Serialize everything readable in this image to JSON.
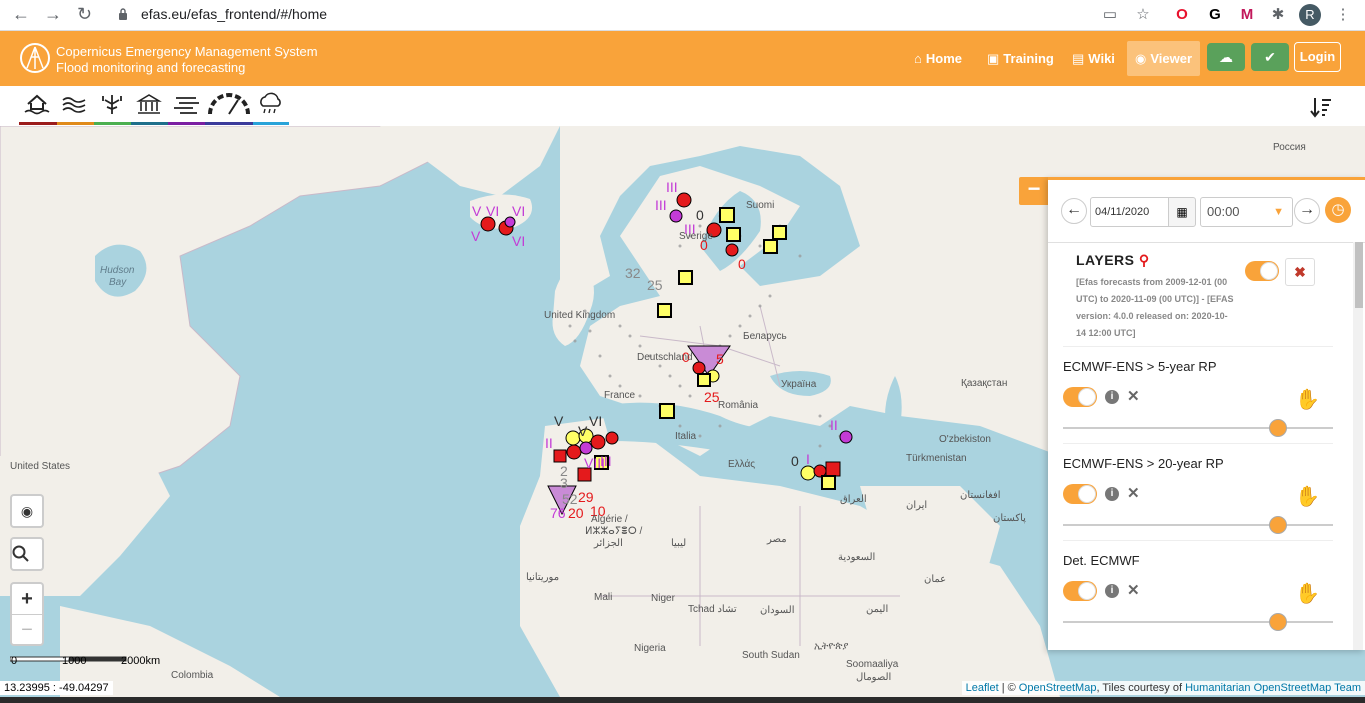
{
  "browser": {
    "url": "efas.eu/efas_frontend/#/home",
    "profile_initial": "R"
  },
  "header": {
    "title_line1": "Copernicus Emergency Management System",
    "title_line2": "Flood monitoring and forecasting",
    "menu": [
      {
        "label": "Home",
        "icon": "home-icon"
      },
      {
        "label": "Training",
        "icon": "training-icon"
      },
      {
        "label": "Wiki",
        "icon": "wiki-icon"
      },
      {
        "label": "Viewer",
        "icon": "globe-icon"
      }
    ],
    "login_label": "Login",
    "accent": "#f9a33a"
  },
  "toolbar": {
    "tools": [
      {
        "name": "flood-tool",
        "color": "#9b1c1c"
      },
      {
        "name": "river-tool",
        "color": "#e08a1a"
      },
      {
        "name": "tree-tool",
        "color": "#4caf50"
      },
      {
        "name": "building-tool",
        "color": "#1f6f8b"
      },
      {
        "name": "layers-tool",
        "color": "#7b1fa2"
      },
      {
        "name": "gauge-tool",
        "color": "#3b3b9b"
      },
      {
        "name": "rain-tool",
        "color": "#29a3d9"
      }
    ]
  },
  "map": {
    "labels": {
      "russia": "Россия",
      "hudson": "Hudson",
      "bay": "Bay",
      "uk": "United Kingdom",
      "suomi": "Suomi",
      "sverige": "Sverige",
      "belarus": "Беларусь",
      "deutschland": "Deutschland",
      "ukraine": "Україна",
      "kazakhstan": "Қазақстан",
      "france": "France",
      "romania": "România",
      "italia": "Italia",
      "ellas": "Ελλάς",
      "uzbekistan": "O'zbekiston",
      "turkmenistan": "Türkmenistan",
      "us": "United States",
      "afghanistan": "افغانستان",
      "iraq": "العراق",
      "iran": "ایران",
      "pakistan": "پاکستان",
      "algerie1": "Algérie /",
      "algerie2": "ⵍⵣⵣⴰⵢⴻⵔ /",
      "algerie3": "الجزائر",
      "libya": "ليبيا",
      "egypt": "مصر",
      "saudi": "السعودية",
      "oman": "عمان",
      "yemen": "اليمن",
      "mauritania": "موريتانيا",
      "mali": "Mali",
      "niger": "Niger",
      "tchad": "Tchad تشاد",
      "sudan": "السودان",
      "ethiopia": "ኢትዮጵያ",
      "south_sudan": "South Sudan",
      "somalia1": "Soomaaliya",
      "somalia2": "الصومال",
      "nigeria": "Nigeria",
      "colombia": "Colombia"
    },
    "scale": {
      "l0": "0",
      "l1": "1000",
      "l2": "2000km"
    },
    "coords": "13.23995 : -49.04297",
    "attribution": {
      "leaflet": "Leaflet",
      "sep": " | © ",
      "osm": "OpenStreetMap",
      "tiles": ", Tiles courtesy of ",
      "hot": "Humanitarian OpenStreetMap Team"
    }
  },
  "panel": {
    "date": "04/11/2020",
    "time": "00:00",
    "layers_title": "LAYERS",
    "layers_desc": "[Efas forecasts from 2009-12-01 (00 UTC) to 2020-11-09 (00 UTC)] - [EFAS version: 4.0.0 released on: 2020-10-14 12:00 UTC]",
    "layers": [
      {
        "name": "ECMWF-ENS > 5-year RP",
        "enabled": true,
        "opacity": 0.8
      },
      {
        "name": "ECMWF-ENS > 20-year RP",
        "enabled": true,
        "opacity": 0.8
      },
      {
        "name": "Det. ECMWF",
        "enabled": true,
        "opacity": 0.8
      }
    ]
  }
}
